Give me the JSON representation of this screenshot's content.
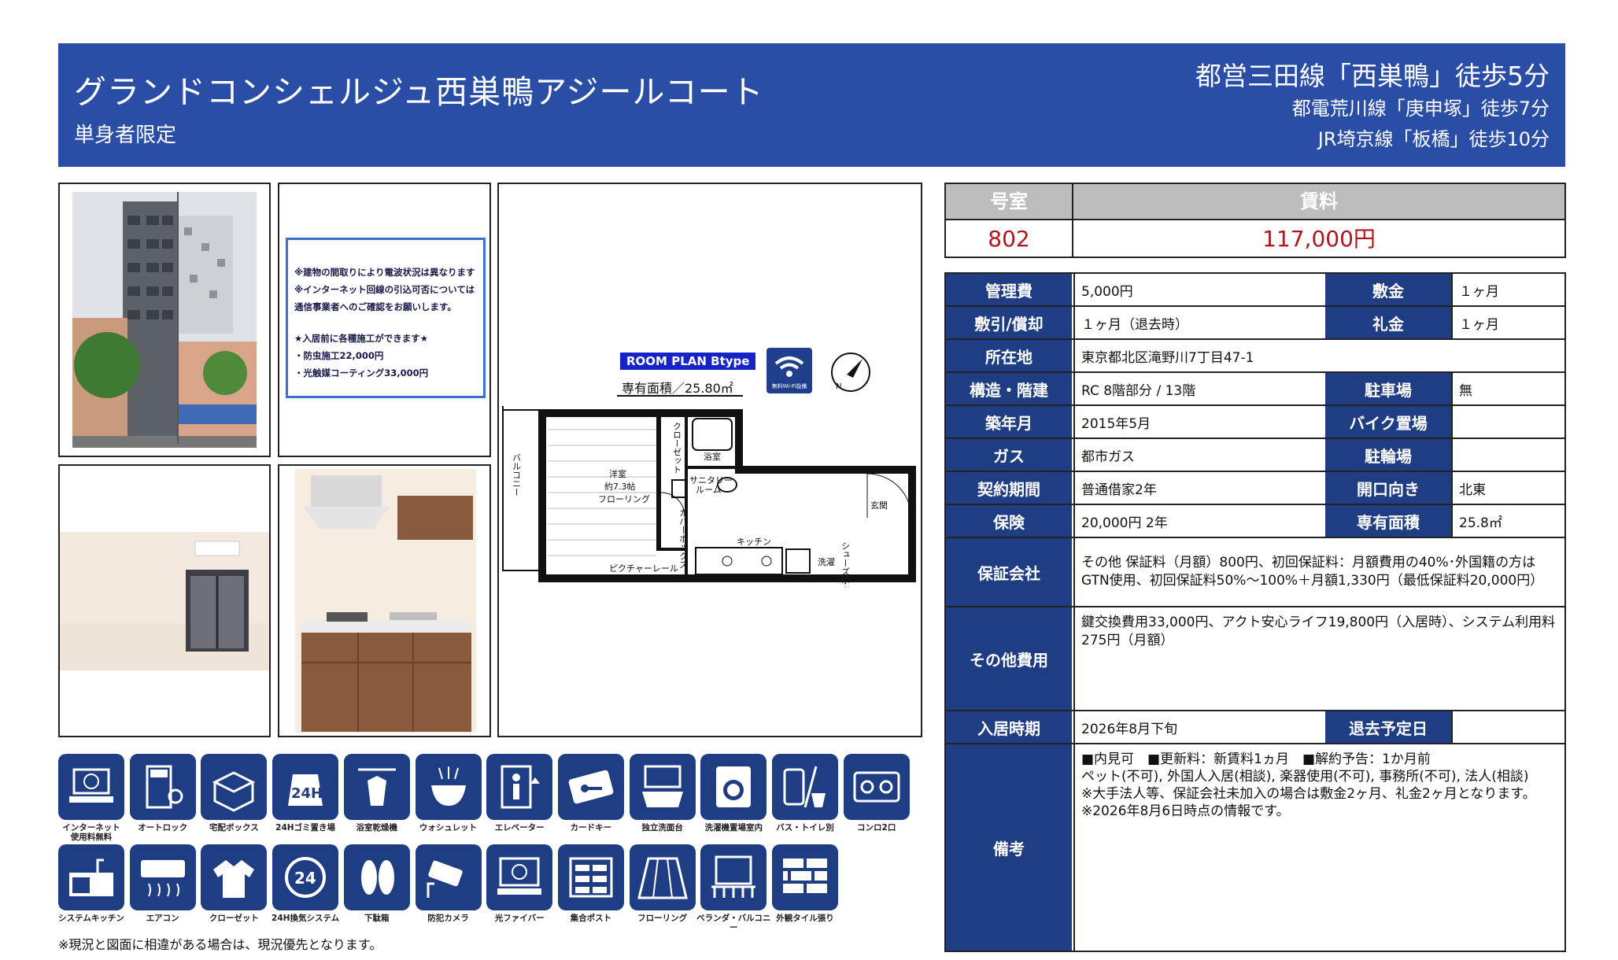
{
  "header": {
    "building_name": "グランドコンシェルジュ西巣鴨アジールコート",
    "subtitle": "単身者限定",
    "stations": [
      "都営三田線「西巣鴨」徒歩5分",
      "都電荒川線「庚申塚」徒歩7分",
      "JR埼京線「板橋」徒歩10分"
    ]
  },
  "notice": {
    "lines": [
      "※建物の間取りにより電波状況は異なります",
      "※インターネット回線の引込可否については",
      "通信事業者へのご確認をお願いします。",
      "★入居前に各種施工ができます★",
      "・防虫施工22,000円",
      "・光触媒コーティング33,000円"
    ]
  },
  "floor_plan": {
    "label": "ROOM PLAN  Btype",
    "area_text": "専有面積／25.80㎡",
    "wifi_caption": "無料Wi-Fi設備",
    "compass_letter": "N",
    "rooms": {
      "closet": "クローゼット",
      "bath": "浴室",
      "balcony": "バルコニー",
      "western_room": "洋室",
      "size": "約7.3帖",
      "flooring": "フローリング",
      "sanitary": "サニタリー",
      "sanitary2": "ルーム",
      "cover_box": "カバーボックス",
      "entrance": "玄関",
      "kitchen": "キッチン",
      "washer": "洗濯",
      "shoebox": "シューズボックス",
      "rail": "ピクチャーレール"
    }
  },
  "amenities": [
    {
      "label": "インターネット\n使用料無料",
      "icon": "internet-free-icon"
    },
    {
      "label": "オートロック",
      "icon": "auto-lock-icon"
    },
    {
      "label": "宅配ボックス",
      "icon": "delivery-box-icon"
    },
    {
      "label": "24Hゴミ置き場",
      "icon": "trash-24h-icon"
    },
    {
      "label": "浴室乾燥機",
      "icon": "bath-dryer-icon"
    },
    {
      "label": "ウォシュレット",
      "icon": "washlet-icon"
    },
    {
      "label": "エレベーター",
      "icon": "elevator-icon"
    },
    {
      "label": "カードキー",
      "icon": "card-key-icon"
    },
    {
      "label": "独立洗面台",
      "icon": "vanity-icon"
    },
    {
      "label": "洗濯機置場室内",
      "icon": "washing-machine-icon"
    },
    {
      "label": "バス・トイレ別",
      "icon": "bath-toilet-separate-icon"
    },
    {
      "label": "コンロ2口",
      "icon": "stove-icon"
    },
    {
      "label": "システムキッチン",
      "icon": "system-kitchen-icon"
    },
    {
      "label": "エアコン",
      "icon": "air-conditioner-icon"
    },
    {
      "label": "クローゼット",
      "icon": "closet-icon"
    },
    {
      "label": "24H換気システム",
      "icon": "ventilation-24h-icon"
    },
    {
      "label": "下駄箱",
      "icon": "shoe-box-icon"
    },
    {
      "label": "防犯カメラ",
      "icon": "security-camera-icon"
    },
    {
      "label": "光ファイバー",
      "icon": "fiber-optic-icon"
    },
    {
      "label": "集合ポスト",
      "icon": "mailbox-icon"
    },
    {
      "label": "フローリング",
      "icon": "flooring-icon"
    },
    {
      "label": "ベランダ・バルコニー",
      "icon": "balcony-icon"
    },
    {
      "label": "外観タイル張り",
      "icon": "tile-exterior-icon"
    }
  ],
  "footnote": "※現況と図面に相違がある場合は、現況優先となります。",
  "rent": {
    "room_label": "号室",
    "room": "802",
    "rent_label": "賃料",
    "rent": "117,000円"
  },
  "details": {
    "kanrihi_label": "管理費",
    "kanrihi": "5,000円",
    "shikikin_label": "敷金",
    "shikikin": "１ヶ月",
    "shikibiki_label": "敷引/償却",
    "shikibiki": "１ヶ月（退去時）",
    "reikin_label": "礼金",
    "reikin": "１ヶ月",
    "address_label": "所在地",
    "address": "東京都北区滝野川7丁目47-1",
    "structure_label": "構造・階建",
    "structure": "RC 8階部分 / 13階",
    "parking_label": "駐車場",
    "parking": "無",
    "built_label": "築年月",
    "built": "2015年5月",
    "bike_label": "バイク置場",
    "bike": "",
    "gas_label": "ガス",
    "gas": "都市ガス",
    "bicycle_label": "駐輪場",
    "bicycle": "",
    "contract_label": "契約期間",
    "contract": "普通借家2年",
    "direction_label": "開口向き",
    "direction": "北東",
    "insurance_label": "保険",
    "insurance": "20,000円 2年",
    "area_label": "専有面積",
    "area": "25.8㎡",
    "guarantor_label": "保証会社",
    "guarantor": "その他 保証料（月額）800円、初回保証料：月額費用の40%･外国籍の方はGTN使用、初回保証料50%〜100%＋月額1,330円（最低保証料20,000円）",
    "other_fees_label": "その他費用",
    "other_fees": "鍵交換費用33,000円、アクト安心ライフ19,800円（入居時）、システム利用料275円（月額）",
    "move_in_label": "入居時期",
    "move_in": "2026年8月下旬",
    "move_out_label": "退去予定日",
    "move_out": "",
    "remarks_label": "備考",
    "remarks": [
      "■内見可　■更新料：新賃料1ヵ月　■解約予告：1か月前",
      "ペット(不可), 外国人入居(相談), 楽器使用(不可), 事務所(不可), 法人(相談)",
      "※大手法人等、保証会社未加入の場合は敷金2ヶ月、礼金2ヶ月となります。",
      "※2026年8月6日時点の情報です。"
    ]
  },
  "colors": {
    "header_blue": "#2a4ea6",
    "label_blue": "#1e3d82",
    "rent_red": "#b0161c",
    "head_gray": "#bdbdbd"
  }
}
